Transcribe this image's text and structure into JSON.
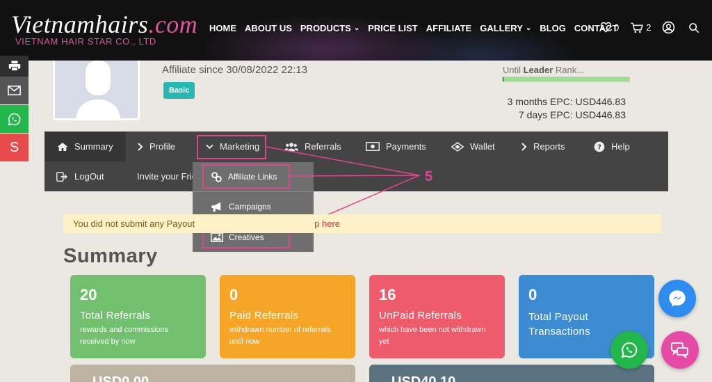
{
  "header": {
    "logo_main": "Vietnamhairs",
    "logo_tld": ".com",
    "logo_sub": "VIETNAM HAIR STAR CO., LTD",
    "nav": [
      {
        "label": "HOME"
      },
      {
        "label": "ABOUT US"
      },
      {
        "label": "PRODUCTS",
        "dropdown": true
      },
      {
        "label": "PRICE LIST"
      },
      {
        "label": "AFFILIATE"
      },
      {
        "label": "GALLERY",
        "dropdown": true
      },
      {
        "label": "BLOG"
      },
      {
        "label": "CONTACT"
      }
    ],
    "wishlist_count": "0",
    "cart_count": "2"
  },
  "share": {
    "s_label": "S"
  },
  "profile": {
    "affiliate_since": "Affiliate since 30/08/2022 22:13",
    "badge": "Basic",
    "rank_prefix": "Until",
    "rank_name": "Leader",
    "rank_suffix": "Rank...",
    "rank_progress": 0.01,
    "epc_3m": "3 months EPC: USD446.83",
    "epc_7d": "7 days EPC: USD446.83"
  },
  "tabs": {
    "summary": "Summary",
    "profile": "Profile",
    "marketing": "Marketing",
    "referrals": "Referrals",
    "payments": "Payments",
    "wallet": "Wallet",
    "reports": "Reports",
    "help": "Help",
    "logout": "LogOut",
    "invite": "Invite your Frie"
  },
  "dropdown": {
    "affiliate_links": "Affiliate Links",
    "campaigns": "Campaigns",
    "creatives": "Creatives"
  },
  "annotation": {
    "step": "5"
  },
  "notice": {
    "text": "You did not submit any Payout",
    "link": "p here"
  },
  "summary": {
    "title": "Summary",
    "cards": [
      {
        "num": "20",
        "label": "Total Referrals",
        "desc1": "rewards and commissions",
        "desc2": "received by now"
      },
      {
        "num": "0",
        "label": "Paid Referrals",
        "desc1": "withdrawn number of referrals",
        "desc2": "until now"
      },
      {
        "num": "16",
        "label": "UnPaid Referrals",
        "desc1": "which have been not withdrawn",
        "desc2": "yet"
      },
      {
        "num": "0",
        "label": "Total Payout",
        "label2": "Transactions"
      }
    ],
    "lower_left": "USD0.00",
    "lower_right": "USD40.10"
  },
  "colors": {
    "accent_pink": "#e0458f",
    "card_green": "#72c06f",
    "card_orange": "#f6a526",
    "card_red": "#ee5b6b",
    "card_blue": "#3d8cd2"
  }
}
